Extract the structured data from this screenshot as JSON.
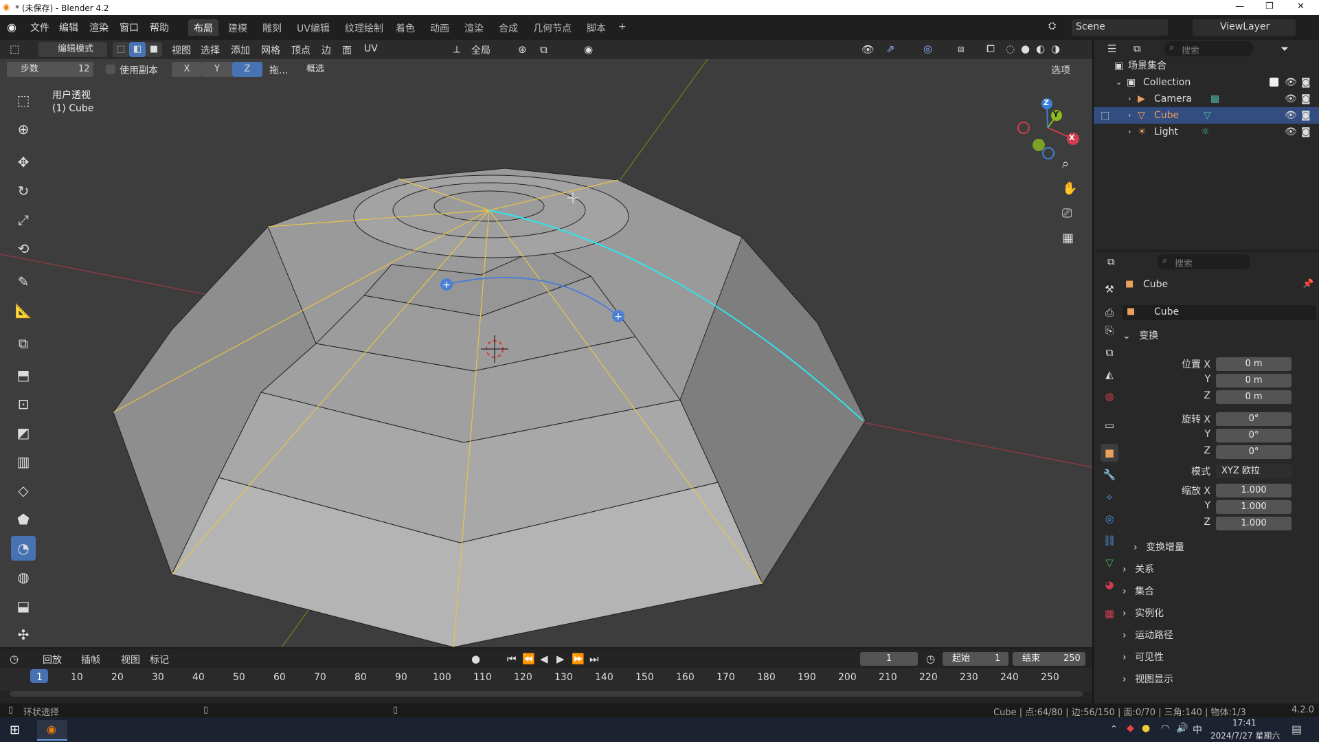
{
  "window": {
    "title": "* (未保存) - Blender 4.2"
  },
  "menu": {
    "items": [
      "文件",
      "编辑",
      "渲染",
      "窗口",
      "帮助"
    ],
    "workspaces": [
      "布局",
      "建模",
      "雕刻",
      "UV编辑",
      "纹理绘制",
      "着色",
      "动画",
      "渲染",
      "合成",
      "几何节点",
      "脚本"
    ],
    "add_tab": "+",
    "scene_label": "Scene",
    "viewlayer_label": "ViewLayer"
  },
  "viewport_header": {
    "mode": "编辑模式",
    "menus": [
      "视图",
      "选择",
      "添加",
      "网格",
      "顶点",
      "边",
      "面",
      "UV"
    ],
    "orientation": "全局",
    "options": "选项"
  },
  "operator": {
    "steps_label": "步数",
    "steps_value": "12",
    "use_duplicate": "使用副本",
    "axes": [
      "X",
      "Y",
      "Z"
    ],
    "drag": "拖...",
    "select_mode": "概选"
  },
  "viewport": {
    "view_name": "用户透视",
    "object_name": "(1) Cube",
    "gizmo_axes": [
      "X",
      "Y",
      "Z"
    ]
  },
  "outliner": {
    "title": "场景集合",
    "search_placeholder": "搜索",
    "collection": "Collection",
    "objects": [
      "Camera",
      "Cube",
      "Light"
    ]
  },
  "properties": {
    "search_placeholder": "搜索",
    "object_name": "Cube",
    "data_name": "Cube",
    "transform_title": "变换",
    "location_label": "位置 X",
    "location": [
      "0 m",
      "0 m",
      "0 m"
    ],
    "rotation_label": "旋转 X",
    "rotation": [
      "0°",
      "0°",
      "0°"
    ],
    "mode_label": "模式",
    "mode_value": "XYZ 欧拉",
    "scale_label": "缩放 X",
    "scale": [
      "1.000",
      "1.000",
      "1.000"
    ],
    "axis_y": "Y",
    "axis_z": "Z",
    "delta": "变换增量",
    "sections": [
      "关系",
      "集合",
      "实例化",
      "运动路径",
      "可见性",
      "视图显示"
    ]
  },
  "timeline": {
    "menus": [
      "回放",
      "插帧",
      "视图",
      "标记"
    ],
    "current_frame": "1",
    "start_label": "起始",
    "start": "1",
    "end_label": "结束",
    "end": "250",
    "ticks": [
      "1",
      "10",
      "20",
      "30",
      "40",
      "50",
      "60",
      "70",
      "80",
      "90",
      "100",
      "110",
      "120",
      "130",
      "140",
      "150",
      "160",
      "170",
      "180",
      "190",
      "200",
      "210",
      "220",
      "230",
      "240",
      "250"
    ]
  },
  "status": {
    "hint": "环状选择",
    "stats": "Cube | 点:64/80 | 边:56/150 | 面:0/70 | 三角:140 | 物体:1/3",
    "version": "4.2.0"
  },
  "taskbar": {
    "time": "17:41",
    "date": "2024/7/27 星期六",
    "ime": "中"
  },
  "colors": {
    "accent": "#4772b3",
    "selected_edge": "#e8c547",
    "active_edge": "#2ee6f0",
    "x_axis": "#cf3d4f",
    "y_axis": "#8cba1f"
  }
}
